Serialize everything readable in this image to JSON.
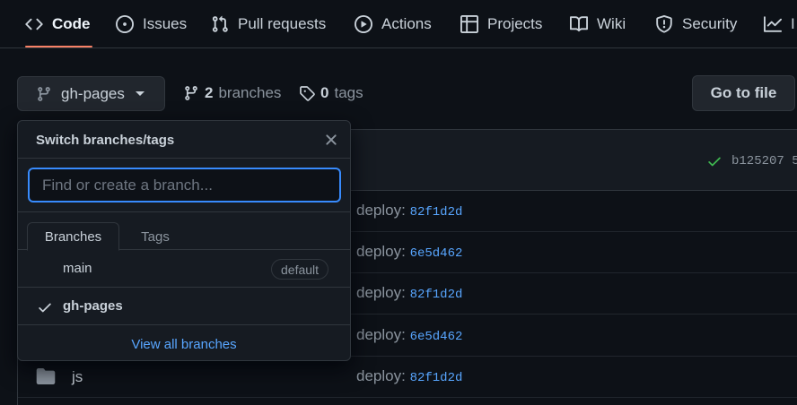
{
  "nav": {
    "tabs": [
      {
        "label": "Code",
        "icon": "code-icon",
        "selected": true
      },
      {
        "label": "Issues",
        "icon": "issue-opened-icon"
      },
      {
        "label": "Pull requests",
        "icon": "git-pull-request-icon"
      },
      {
        "label": "Actions",
        "icon": "play-icon"
      },
      {
        "label": "Projects",
        "icon": "table-icon"
      },
      {
        "label": "Wiki",
        "icon": "book-icon"
      },
      {
        "label": "Security",
        "icon": "shield-icon"
      },
      {
        "label": "I",
        "icon": "graph-icon"
      }
    ]
  },
  "toolbar": {
    "branch_button_label": "gh-pages",
    "branches_count": "2",
    "branches_label": "branches",
    "tags_count": "0",
    "tags_label": "tags",
    "goto_file_label": "Go to file"
  },
  "commit": {
    "sha": "b125207",
    "sha_trailing": "5",
    "status": "success"
  },
  "files": [
    {
      "name": "",
      "message": "deploy:",
      "commit": "82f1d2d"
    },
    {
      "name": "",
      "message": "deploy:",
      "commit": "6e5d462"
    },
    {
      "name": "",
      "message": "deploy:",
      "commit": "82f1d2d"
    },
    {
      "name": "",
      "message": "deploy:",
      "commit": "6e5d462"
    },
    {
      "name": "js",
      "message": "deploy:",
      "commit": "82f1d2d"
    }
  ],
  "dropdown": {
    "title": "Switch branches/tags",
    "filter_placeholder": "Find or create a branch...",
    "filter_value": "",
    "tabs": {
      "branches": "Branches",
      "tags": "Tags"
    },
    "items": [
      {
        "name": "main",
        "badge": "default",
        "selected": false
      },
      {
        "name": "gh-pages",
        "badge": "",
        "selected": true
      }
    ],
    "footer_link": "View all branches"
  },
  "colors": {
    "background": "#0d1117",
    "accent_underline": "#f78166",
    "link": "#58a6ff",
    "success": "#3fb950",
    "focus_border": "#388bfd"
  }
}
